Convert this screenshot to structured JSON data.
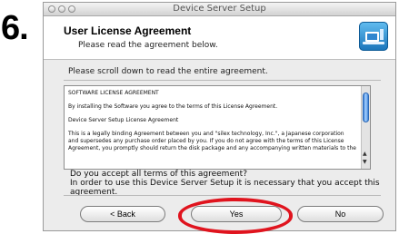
{
  "step_number": "6.",
  "window": {
    "title": "Device Server Setup"
  },
  "header": {
    "title": "User License Agreement",
    "subtitle": "Please read the agreement below.",
    "icon": "installer-app-icon"
  },
  "instructions": "Please scroll down to read the entire agreement.",
  "license": {
    "lines": [
      "SOFTWARE LICENSE AGREEMENT",
      "",
      "By installing the Software you agree to the terms of this License Agreement.",
      "",
      "Device Server Setup License Agreement",
      "",
      "This is a legally binding Agreement between you and \"silex technology, Inc.\", a Japanese corporation",
      "and supersedes any purchase order placed by you.  If you do not agree with the terms of this License",
      "Agreement, you promptly should return the disk package and any accompanying written materials to the"
    ]
  },
  "question": {
    "line1": "Do you accept all terms of this agreement?",
    "line2": "In order to use this Device Server Setup it is necessary that you accept this agreement."
  },
  "buttons": {
    "back": "< Back",
    "yes": "Yes",
    "no": "No"
  },
  "colors": {
    "highlight_ring": "#e0141e",
    "scroll_thumb": "#3c82d8"
  }
}
